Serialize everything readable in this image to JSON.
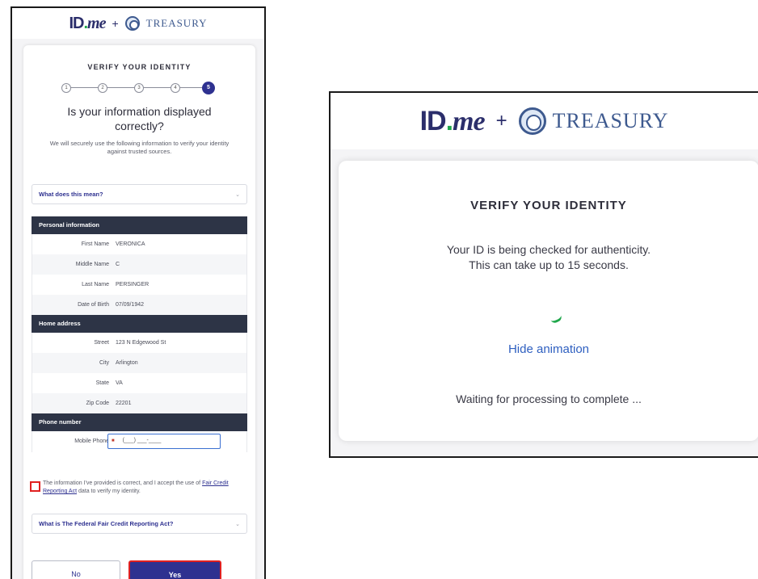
{
  "brand": {
    "idme_main": "ID",
    "idme_dot": ".",
    "idme_me": "me",
    "plus": "+",
    "treasury": "TREASURY",
    "colors": {
      "idme_navy": "#2b2e6b",
      "idme_green": "#1fa74b",
      "treasury_blue": "#3e5a8f"
    }
  },
  "left": {
    "title": "VERIFY YOUR IDENTITY",
    "steps": [
      "1",
      "2",
      "3",
      "4",
      "5"
    ],
    "current_step": 5,
    "question": "Is your information displayed correctly?",
    "subtitle": "We will securely use the following information to verify your identity against trusted sources.",
    "accordion_1": "What does this mean?",
    "personal": {
      "header": "Personal information",
      "rows": [
        {
          "label": "First Name",
          "value": "VERONICA"
        },
        {
          "label": "Middle Name",
          "value": "C"
        },
        {
          "label": "Last Name",
          "value": "PERSINGER"
        },
        {
          "label": "Date of Birth",
          "value": "07/09/1942"
        }
      ]
    },
    "address": {
      "header": "Home address",
      "rows": [
        {
          "label": "Street",
          "value": "123 N Edgewood St"
        },
        {
          "label": "City",
          "value": "Arlington"
        },
        {
          "label": "State",
          "value": "VA"
        },
        {
          "label": "Zip Code",
          "value": "22201"
        }
      ]
    },
    "phone": {
      "header": "Phone number",
      "label": "Mobile Phone",
      "value": "(___) ___-____"
    },
    "consent_prefix": "The information I've provided is correct, and I accept the use of ",
    "consent_link": "Fair Credit Reporting Act",
    "consent_suffix": " data to verify my identity.",
    "accordion_2": "What is The Federal Fair Credit Reporting Act?",
    "btn_no": "No",
    "btn_yes": "Yes",
    "colors": {
      "primary": "#2e3190",
      "section_header": "#2d3446",
      "highlight_red": "#e02020"
    }
  },
  "right": {
    "title": "VERIFY YOUR IDENTITY",
    "message_line1": "Your ID is being checked for authenticity.",
    "message_line2": "This can take up to 15 seconds.",
    "hide_animation": "Hide animation",
    "waiting": "Waiting for processing to complete ...",
    "colors": {
      "link": "#2e5fc0",
      "spinner": "#1fa74b"
    }
  }
}
